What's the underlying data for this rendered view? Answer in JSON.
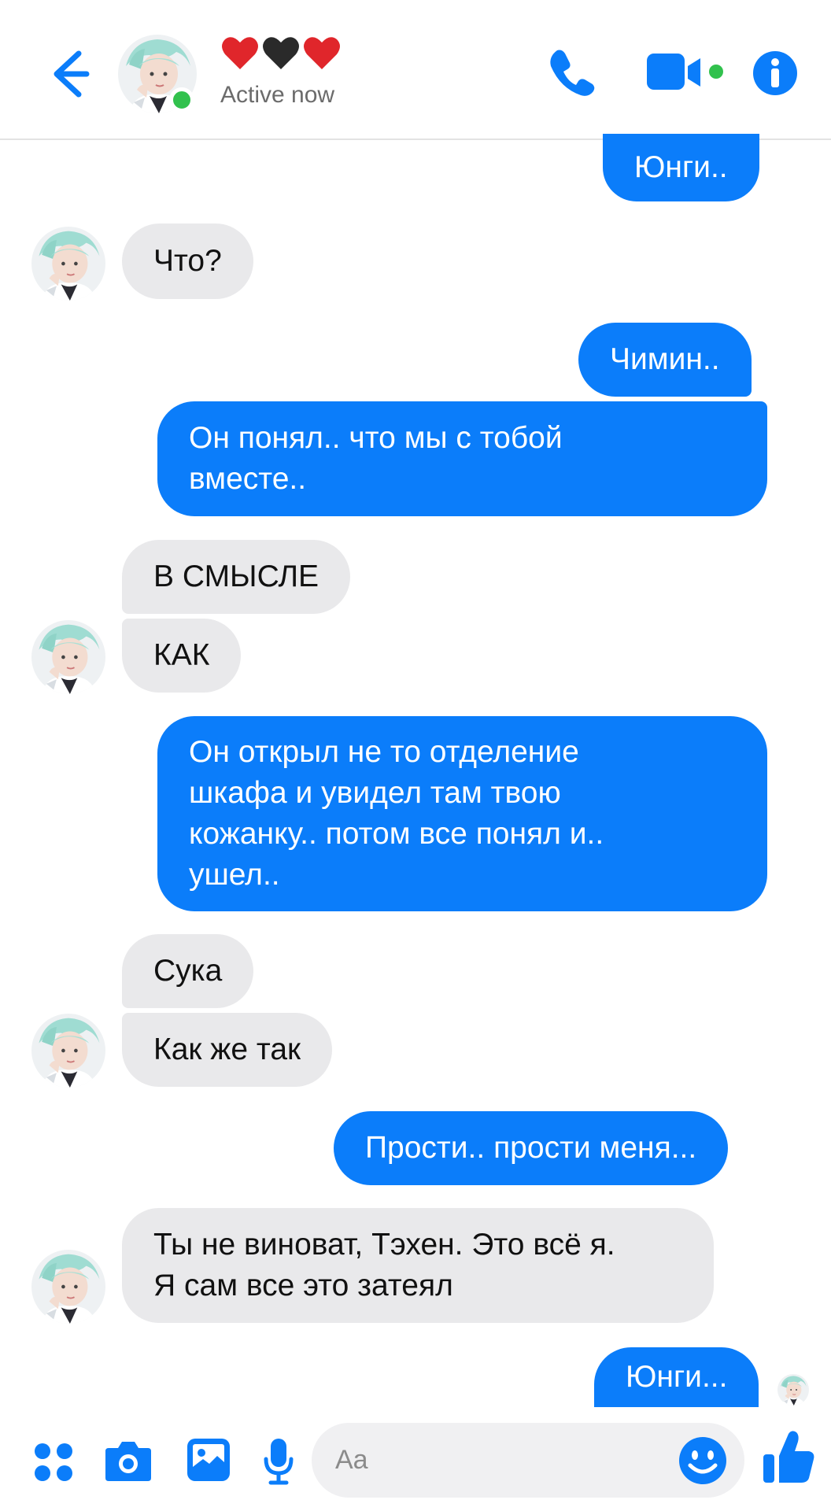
{
  "header": {
    "status": "Active now",
    "hearts": [
      "❤",
      "🖤",
      "❤"
    ],
    "accent": "#0b7dfa",
    "online_color": "#31c14d"
  },
  "messages": [
    {
      "dir": "out",
      "text": "Юнги.."
    },
    {
      "dir": "in",
      "text": "Что?"
    },
    {
      "dir": "out",
      "text": "Чимин.."
    },
    {
      "dir": "out",
      "text": "Он понял.. что мы с тобой\nвместе.."
    },
    {
      "dir": "in",
      "text": "В СМЫСЛЕ"
    },
    {
      "dir": "in",
      "text": "КАК"
    },
    {
      "dir": "out",
      "text": "Он открыл не то отделение\nшкафа и увидел там твою\nкожанку.. потом все понял и..\nушел.."
    },
    {
      "dir": "in",
      "text": "Сука"
    },
    {
      "dir": "in",
      "text": "Как же так"
    },
    {
      "dir": "out",
      "text": "Прости.. прости меня..."
    },
    {
      "dir": "in",
      "text": "Ты не виноват, Тэхен. Это всё я.\nЯ сам все это затеял"
    },
    {
      "dir": "out",
      "text": "Юнги..."
    }
  ],
  "composer": {
    "placeholder": "Aa"
  },
  "icons": {
    "back": "arrow-left-icon",
    "call": "phone-icon",
    "video": "video-camera-icon",
    "info": "info-icon",
    "apps": "apps-grid-icon",
    "camera": "camera-icon",
    "gallery": "image-icon",
    "mic": "microphone-icon",
    "emoji": "emoji-smile-icon",
    "like": "thumbs-up-icon"
  }
}
